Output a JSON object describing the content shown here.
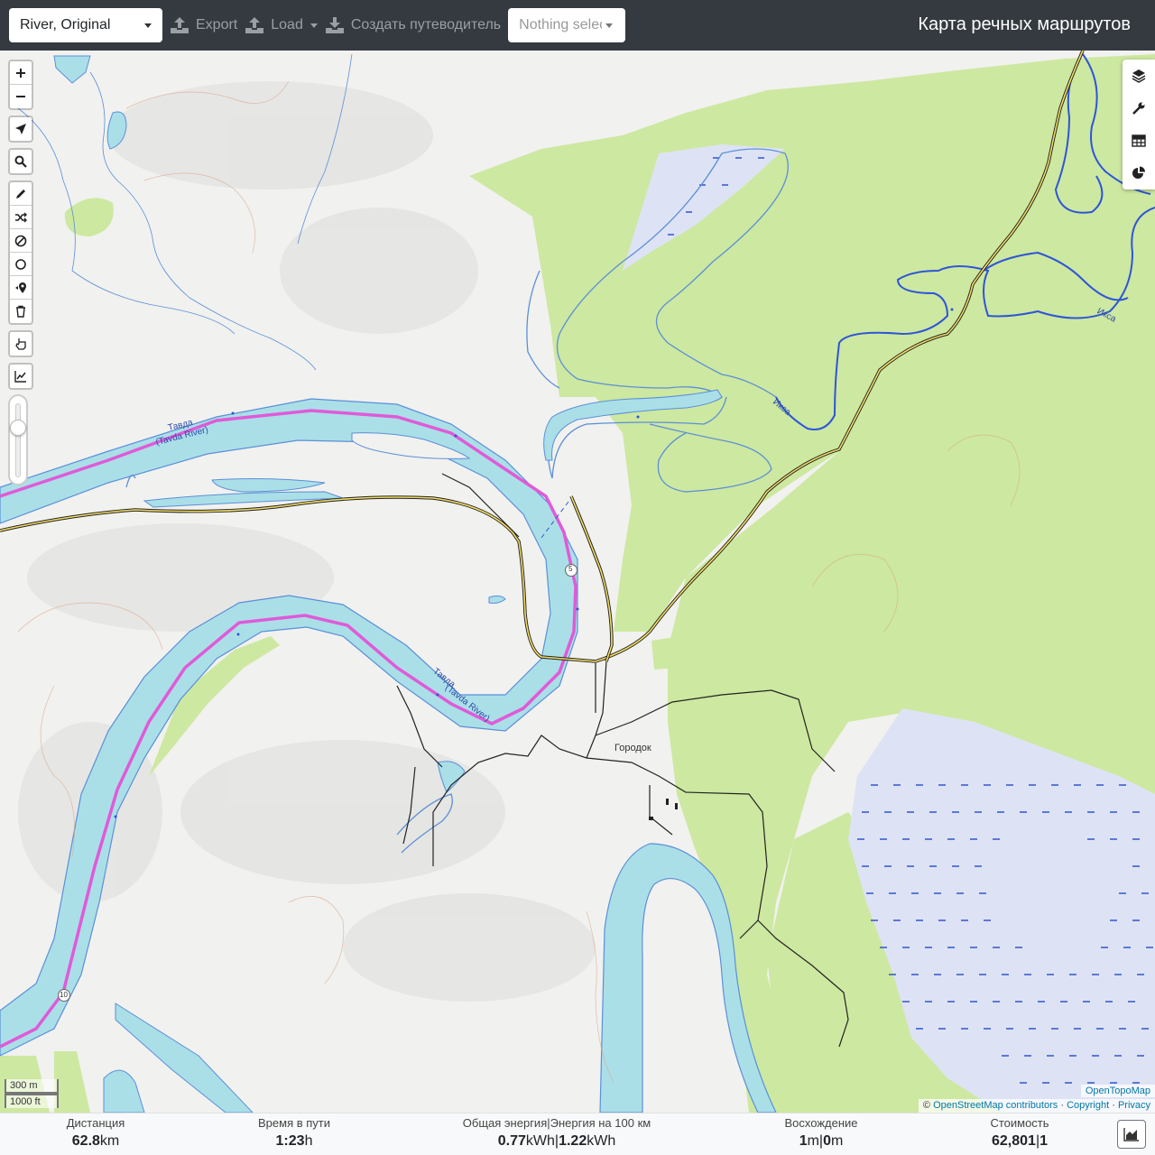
{
  "navbar": {
    "profile_select": "River, Original",
    "export_label": "Export",
    "load_label": "Load",
    "guide_label": "Создать путеводитель",
    "track_select": "Nothing selected",
    "brand": "Карта речных маршрутов"
  },
  "map": {
    "labels": {
      "tavda_ru_1": "Тавда",
      "tavda_en_1": "(Tavda River)",
      "tavda_ru_2": "Тавда",
      "tavda_en_2": "(Tavda River)",
      "iksa_1": "Икса",
      "iksa_2": "Икса",
      "town": "Городок",
      "km_5": "5",
      "km_10": "10"
    },
    "colors": {
      "forest": "#cde8a0",
      "water": "#aadfe8",
      "river_outline": "#5b8fd8",
      "route": "#e05ad8",
      "road": "#c9a800",
      "track": "#222222"
    }
  },
  "controls": {
    "left": [
      "zoom-in",
      "zoom-out",
      "locate",
      "search",
      "draw",
      "reverse",
      "avoid",
      "circle",
      "delete-point",
      "delete-all",
      "pointer",
      "elevation-chart"
    ],
    "right": [
      "layers",
      "settings",
      "table",
      "stats"
    ]
  },
  "scale": {
    "metric": "300 m",
    "imperial": "1000 ft"
  },
  "attribution": {
    "top": "OpenTopoMap",
    "prefix": "©",
    "osm": "OpenStreetMap contributors",
    "sep1": "·",
    "copyright": "Copyright",
    "sep2": "·",
    "privacy": "Privacy"
  },
  "stats": {
    "distance": {
      "label": "Дистанция",
      "value": "62.8",
      "unit": "km"
    },
    "time": {
      "label": "Время в пути",
      "value": "1:23",
      "unit": "h"
    },
    "energy": {
      "label": "Общая энергия|Энергия на 100 км",
      "value1": "0.77",
      "unit1": "kWh",
      "sep": "|",
      "value2": "1.22",
      "unit2": "kWh"
    },
    "ascent": {
      "label": "Восхождение",
      "value1": "1",
      "unit1": "m",
      "sep": "|",
      "value2": "0",
      "unit2": "m"
    },
    "cost": {
      "label": "Стоимость",
      "value1": "62,801",
      "sep": "|",
      "value2": "1"
    }
  }
}
